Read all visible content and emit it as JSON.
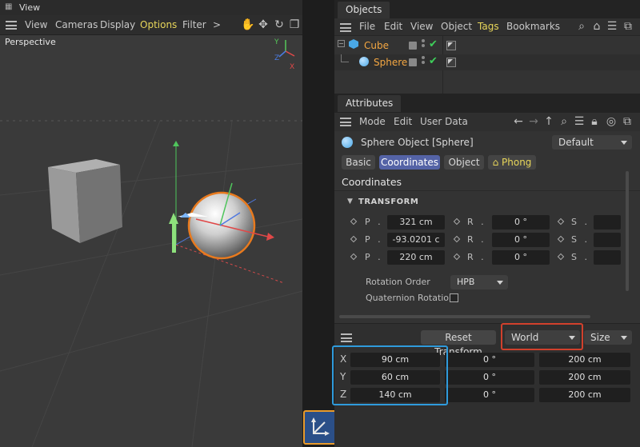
{
  "viewport": {
    "tab_title": "View",
    "menu": [
      "View",
      "Cameras",
      "Display",
      "Options",
      "Filter"
    ],
    "more": ">",
    "camera_label": "Perspective",
    "axis": {
      "x": "X",
      "y": "Y",
      "z": "Z"
    }
  },
  "objects": {
    "tab_title": "Objects",
    "menu": [
      "File",
      "Edit",
      "View",
      "Object",
      "Tags",
      "Bookmarks"
    ],
    "items": [
      {
        "name": "Cube",
        "icon": "cube-icon"
      },
      {
        "name": "Sphere",
        "icon": "sphere-icon"
      }
    ]
  },
  "attributes": {
    "tab_title": "Attributes",
    "menu": [
      "Mode",
      "Edit",
      "User Data"
    ],
    "object_title": "Sphere Object [Sphere]",
    "preset": "Default",
    "tabs": [
      "Basic",
      "Coordinates",
      "Object",
      "Phong"
    ],
    "active_tab": "Coordinates",
    "section_title": "Coordinates",
    "group_title": "TRANSFORM",
    "rows": [
      {
        "p_label": "P . X",
        "p_value": "321 cm",
        "r_label": "R . H",
        "r_value": "0 °",
        "s_label": "S . X"
      },
      {
        "p_label": "P . Y",
        "p_value": "-93.0201 c",
        "r_label": "R . P",
        "r_value": "0 °",
        "s_label": "S . Y"
      },
      {
        "p_label": "P . Z",
        "p_value": "220 cm",
        "r_label": "R . B",
        "r_value": "0 °",
        "s_label": "S . Z"
      }
    ],
    "rotation_order_label": "Rotation Order",
    "rotation_order_value": "HPB",
    "quaternion_label": "Quaternion Rotation"
  },
  "coordinates_manager": {
    "reset_label": "Reset Transform",
    "space": "World",
    "mode": "Size",
    "rows": [
      {
        "axis": "X",
        "pos": "90 cm",
        "rot": "0 °",
        "size": "200 cm"
      },
      {
        "axis": "Y",
        "pos": "60 cm",
        "rot": "0 °",
        "size": "200 cm"
      },
      {
        "axis": "Z",
        "pos": "140 cm",
        "rot": "0 °",
        "size": "200 cm"
      }
    ]
  },
  "colors": {
    "accent_orange": "#f4a742",
    "active_tab": "#5463a6",
    "highlight_blue": "#2f9bdc",
    "highlight_red": "#d1402c",
    "highlight_orange": "#e99a2a"
  }
}
